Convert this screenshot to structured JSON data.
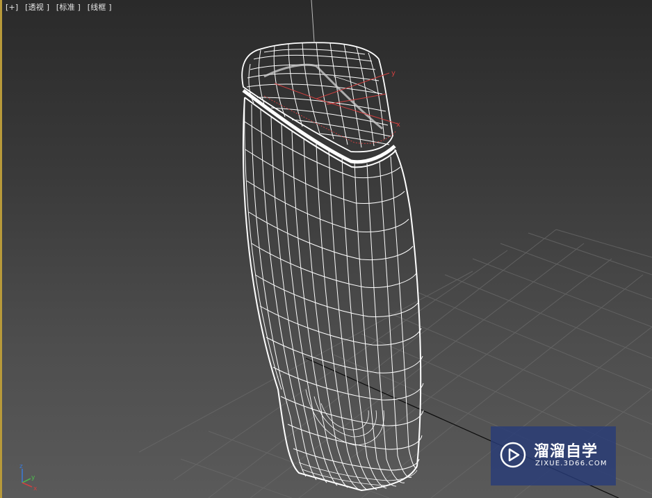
{
  "viewport": {
    "labels": {
      "plus": "[+]",
      "view": "[透视 ]",
      "shading": "[标准 ]",
      "mode": "[线框 ]"
    },
    "gizmo": {
      "y_label": "y",
      "x_label": "x",
      "z_label": "z"
    },
    "axis_icon": {
      "z": "z",
      "y": "y",
      "x": "x"
    }
  },
  "watermark": {
    "title": "溜溜自学",
    "url": "ZIXUE.3D66.COM",
    "logo_icon": "play-icon"
  },
  "colors": {
    "viewport_bg": "#3a3a3a",
    "wireframe": "#ffffff",
    "gizmo": "#d04040",
    "watermark_bg": "#283c78",
    "border_accent": "#b89a3a"
  }
}
